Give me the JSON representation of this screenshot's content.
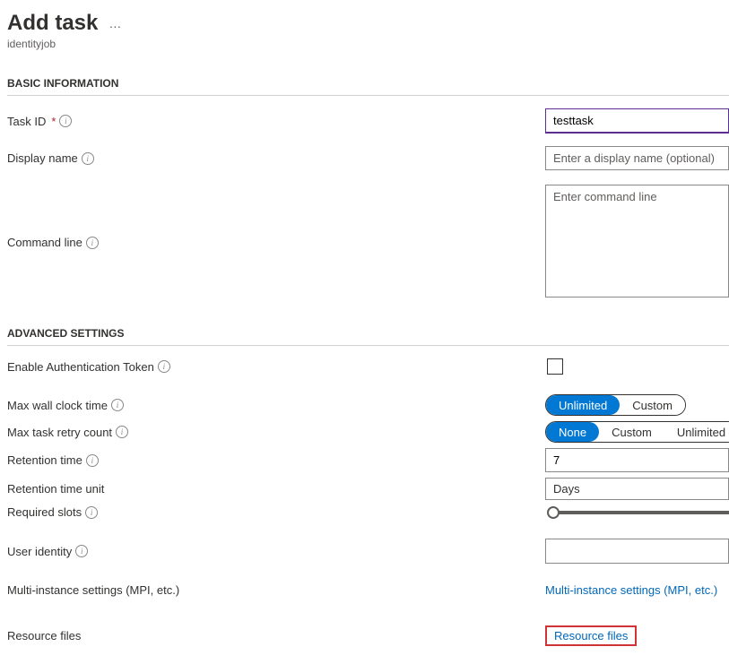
{
  "header": {
    "title": "Add task",
    "ellipsis": "…",
    "subtitle": "identityjob"
  },
  "sections": {
    "basic": "Basic Information",
    "advanced": "Advanced Settings"
  },
  "basic": {
    "task_id": {
      "label": "Task ID",
      "value": "testtask",
      "required": true
    },
    "display_name": {
      "label": "Display name",
      "placeholder": "Enter a display name (optional)",
      "value": ""
    },
    "command_line": {
      "label": "Command line",
      "placeholder": "Enter command line",
      "value": ""
    }
  },
  "advanced": {
    "enable_auth_token": {
      "label": "Enable Authentication Token",
      "checked": false
    },
    "max_wall_clock": {
      "label": "Max wall clock time",
      "options": [
        "Unlimited",
        "Custom"
      ],
      "selected": "Unlimited"
    },
    "max_task_retry": {
      "label": "Max task retry count",
      "options": [
        "None",
        "Custom",
        "Unlimited"
      ],
      "selected": "None"
    },
    "retention_time": {
      "label": "Retention time",
      "value": "7"
    },
    "retention_time_unit": {
      "label": "Retention time unit",
      "value": "Days"
    },
    "required_slots": {
      "label": "Required slots",
      "value": 1
    },
    "user_identity": {
      "label": "User identity",
      "value": ""
    },
    "multi_instance": {
      "label": "Multi-instance settings (MPI, etc.)",
      "link": "Multi-instance settings (MPI, etc.)"
    },
    "resource_files": {
      "label": "Resource files",
      "link": "Resource files"
    }
  }
}
